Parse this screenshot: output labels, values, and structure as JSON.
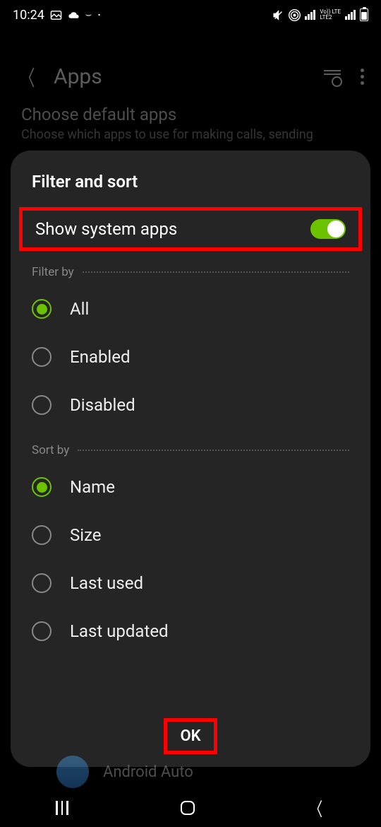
{
  "status": {
    "time": "10:24",
    "lte_label": "Vo)) LTE",
    "lte2_label": "LTE2"
  },
  "background": {
    "title": "Apps",
    "subtitle": "Choose default apps",
    "description": "Choose which apps to use for making calls, sending",
    "app_below": "Android Auto"
  },
  "dialog": {
    "title": "Filter and sort",
    "show_system_label": "Show system apps",
    "show_system_on": true,
    "filter_section": "Filter by",
    "filter_options": [
      {
        "label": "All",
        "selected": true
      },
      {
        "label": "Enabled",
        "selected": false
      },
      {
        "label": "Disabled",
        "selected": false
      }
    ],
    "sort_section": "Sort by",
    "sort_options": [
      {
        "label": "Name",
        "selected": true
      },
      {
        "label": "Size",
        "selected": false
      },
      {
        "label": "Last used",
        "selected": false
      },
      {
        "label": "Last updated",
        "selected": false
      }
    ],
    "ok": "OK"
  },
  "annotation": {
    "highlight_color": "#ff0000"
  }
}
